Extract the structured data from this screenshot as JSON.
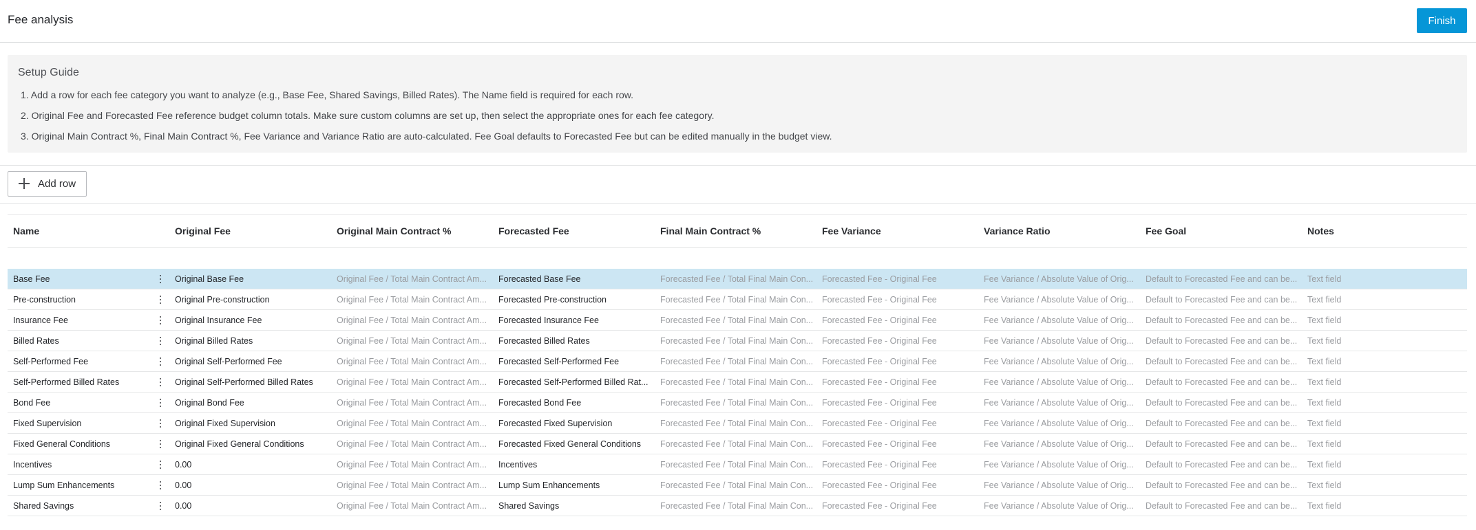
{
  "header": {
    "title": "Fee analysis",
    "finish_label": "Finish"
  },
  "guide": {
    "title": "Setup Guide",
    "steps": [
      "1. Add a row for each fee category you want to analyze (e.g., Base Fee, Shared Savings, Billed Rates). The Name field is required for each row.",
      "2. Original Fee and Forecasted Fee reference budget column totals. Make sure custom columns are set up, then select the appropriate ones for each fee category.",
      "3. Original Main Contract %, Final Main Contract %, Fee Variance and Variance Ratio are auto-calculated. Fee Goal defaults to Forecasted Fee but can be edited manually in the budget view."
    ]
  },
  "toolbar": {
    "add_row_label": "Add row",
    "add_icon": "plus-icon"
  },
  "table": {
    "columns": [
      "Name",
      "Original Fee",
      "Original Main Contract %",
      "Forecasted Fee",
      "Final Main Contract %",
      "Fee Variance",
      "Variance Ratio",
      "Fee Goal",
      "Notes"
    ],
    "selected_row": 0,
    "rows": [
      {
        "name": "Base Fee",
        "original_fee": "Original Base Fee",
        "original_main_pct": "Original Fee / Total Main Contract Am...",
        "forecasted_fee": "Forecasted Base Fee",
        "final_main_pct": "Forecasted Fee / Total Final Main Con...",
        "fee_variance": "Forecasted Fee - Original Fee",
        "variance_ratio": "Fee Variance / Absolute Value of Orig...",
        "fee_goal": "Default to Forecasted Fee and can be...",
        "notes": "Text field"
      },
      {
        "name": "Pre-construction",
        "original_fee": "Original Pre-construction",
        "original_main_pct": "Original Fee / Total Main Contract Am...",
        "forecasted_fee": "Forecasted Pre-construction",
        "final_main_pct": "Forecasted Fee / Total Final Main Con...",
        "fee_variance": "Forecasted Fee - Original Fee",
        "variance_ratio": "Fee Variance / Absolute Value of Orig...",
        "fee_goal": "Default to Forecasted Fee and can be...",
        "notes": "Text field"
      },
      {
        "name": "Insurance Fee",
        "original_fee": "Original Insurance Fee",
        "original_main_pct": "Original Fee / Total Main Contract Am...",
        "forecasted_fee": "Forecasted Insurance Fee",
        "final_main_pct": "Forecasted Fee / Total Final Main Con...",
        "fee_variance": "Forecasted Fee - Original Fee",
        "variance_ratio": "Fee Variance / Absolute Value of Orig...",
        "fee_goal": "Default to Forecasted Fee and can be...",
        "notes": "Text field"
      },
      {
        "name": "Billed Rates",
        "original_fee": "Original Billed Rates",
        "original_main_pct": "Original Fee / Total Main Contract Am...",
        "forecasted_fee": "Forecasted Billed Rates",
        "final_main_pct": "Forecasted Fee / Total Final Main Con...",
        "fee_variance": "Forecasted Fee - Original Fee",
        "variance_ratio": "Fee Variance / Absolute Value of Orig...",
        "fee_goal": "Default to Forecasted Fee and can be...",
        "notes": "Text field"
      },
      {
        "name": "Self-Performed Fee",
        "original_fee": "Original Self-Performed Fee",
        "original_main_pct": "Original Fee / Total Main Contract Am...",
        "forecasted_fee": "Forecasted Self-Performed Fee",
        "final_main_pct": "Forecasted Fee / Total Final Main Con...",
        "fee_variance": "Forecasted Fee - Original Fee",
        "variance_ratio": "Fee Variance / Absolute Value of Orig...",
        "fee_goal": "Default to Forecasted Fee and can be...",
        "notes": "Text field"
      },
      {
        "name": "Self-Performed Billed Rates",
        "original_fee": "Original Self-Performed Billed Rates",
        "original_main_pct": "Original Fee / Total Main Contract Am...",
        "forecasted_fee": "Forecasted Self-Performed Billed Rat...",
        "final_main_pct": "Forecasted Fee / Total Final Main Con...",
        "fee_variance": "Forecasted Fee - Original Fee",
        "variance_ratio": "Fee Variance / Absolute Value of Orig...",
        "fee_goal": "Default to Forecasted Fee and can be...",
        "notes": "Text field"
      },
      {
        "name": "Bond Fee",
        "original_fee": "Original Bond Fee",
        "original_main_pct": "Original Fee / Total Main Contract Am...",
        "forecasted_fee": "Forecasted Bond Fee",
        "final_main_pct": "Forecasted Fee / Total Final Main Con...",
        "fee_variance": "Forecasted Fee - Original Fee",
        "variance_ratio": "Fee Variance / Absolute Value of Orig...",
        "fee_goal": "Default to Forecasted Fee and can be...",
        "notes": "Text field"
      },
      {
        "name": "Fixed Supervision",
        "original_fee": "Original Fixed Supervision",
        "original_main_pct": "Original Fee / Total Main Contract Am...",
        "forecasted_fee": "Forecasted Fixed Supervision",
        "final_main_pct": "Forecasted Fee / Total Final Main Con...",
        "fee_variance": "Forecasted Fee - Original Fee",
        "variance_ratio": "Fee Variance / Absolute Value of Orig...",
        "fee_goal": "Default to Forecasted Fee and can be...",
        "notes": "Text field"
      },
      {
        "name": "Fixed General Conditions",
        "original_fee": "Original Fixed General Conditions",
        "original_main_pct": "Original Fee / Total Main Contract Am...",
        "forecasted_fee": "Forecasted Fixed General Conditions",
        "final_main_pct": "Forecasted Fee / Total Final Main Con...",
        "fee_variance": "Forecasted Fee - Original Fee",
        "variance_ratio": "Fee Variance / Absolute Value of Orig...",
        "fee_goal": "Default to Forecasted Fee and can be...",
        "notes": "Text field"
      },
      {
        "name": "Incentives",
        "original_fee": "0.00",
        "original_main_pct": "Original Fee / Total Main Contract Am...",
        "forecasted_fee": "Incentives",
        "final_main_pct": "Forecasted Fee / Total Final Main Con...",
        "fee_variance": "Forecasted Fee - Original Fee",
        "variance_ratio": "Fee Variance / Absolute Value of Orig...",
        "fee_goal": "Default to Forecasted Fee and can be...",
        "notes": "Text field"
      },
      {
        "name": "Lump Sum Enhancements",
        "original_fee": "0.00",
        "original_main_pct": "Original Fee / Total Main Contract Am...",
        "forecasted_fee": "Lump Sum Enhancements",
        "final_main_pct": "Forecasted Fee / Total Final Main Con...",
        "fee_variance": "Forecasted Fee - Original Fee",
        "variance_ratio": "Fee Variance / Absolute Value of Orig...",
        "fee_goal": "Default to Forecasted Fee and can be...",
        "notes": "Text field"
      },
      {
        "name": "Shared Savings",
        "original_fee": "0.00",
        "original_main_pct": "Original Fee / Total Main Contract Am...",
        "forecasted_fee": "Shared Savings",
        "final_main_pct": "Forecasted Fee / Total Final Main Con...",
        "fee_variance": "Forecasted Fee - Original Fee",
        "variance_ratio": "Fee Variance / Absolute Value of Orig...",
        "fee_goal": "Default to Forecasted Fee and can be...",
        "notes": "Text field"
      }
    ]
  },
  "colors": {
    "accent": "#0696d7",
    "selected_row": "#cce6f3",
    "guide_bg": "#f4f4f4",
    "muted_text": "#9a9ca0"
  }
}
